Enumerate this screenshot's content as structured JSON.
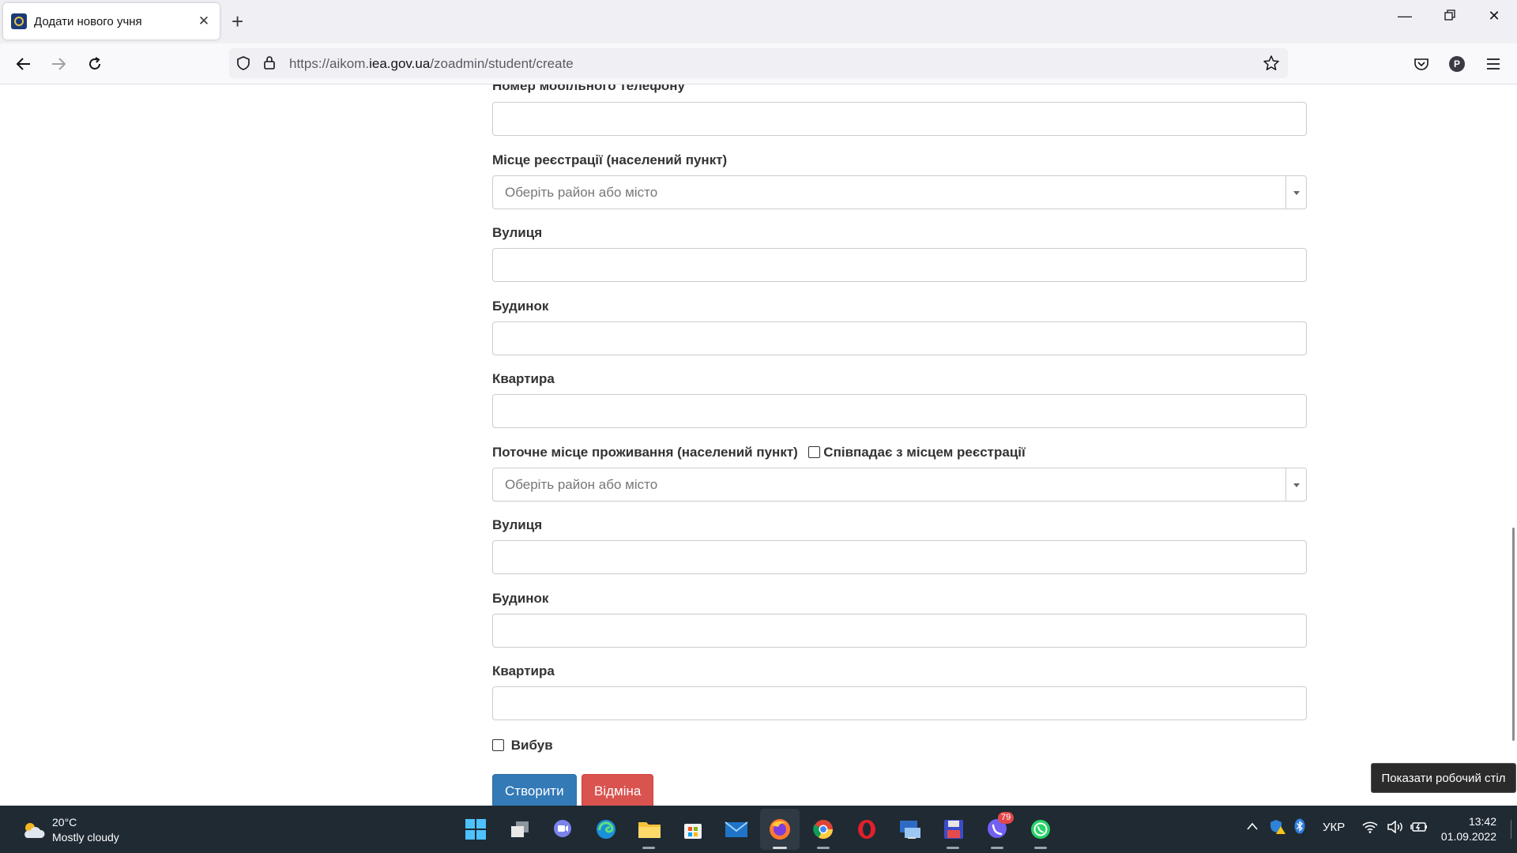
{
  "browser": {
    "tab_title": "Додати нового учня",
    "url_prefix": "https://aikom.",
    "url_domain": "iea.gov.ua",
    "url_path": "/zoadmin/student/create"
  },
  "form": {
    "mobile_phone_label": "Номер мобільного телефону",
    "registration_place_label": "Місце реєстрації (населений пункт)",
    "registration_place_placeholder": "Оберіть район або місто",
    "reg_street_label": "Вулиця",
    "reg_house_label": "Будинок",
    "reg_apartment_label": "Квартира",
    "current_residence_label": "Поточне місце проживання (населений пункт)",
    "same_as_registration_label": "Співпадає з місцем реєстрації",
    "current_residence_placeholder": "Оберіть район або місто",
    "cur_street_label": "Вулиця",
    "cur_house_label": "Будинок",
    "cur_apartment_label": "Квартира",
    "left_school_label": "Вибув",
    "create_button": "Створити",
    "cancel_button": "Відміна"
  },
  "tooltip": "Показати робочий стіл",
  "taskbar": {
    "weather_temp": "20°C",
    "weather_desc": "Mostly cloudy",
    "viber_badge": "79",
    "language": "УКР",
    "time": "13:42",
    "date": "01.09.2022"
  }
}
